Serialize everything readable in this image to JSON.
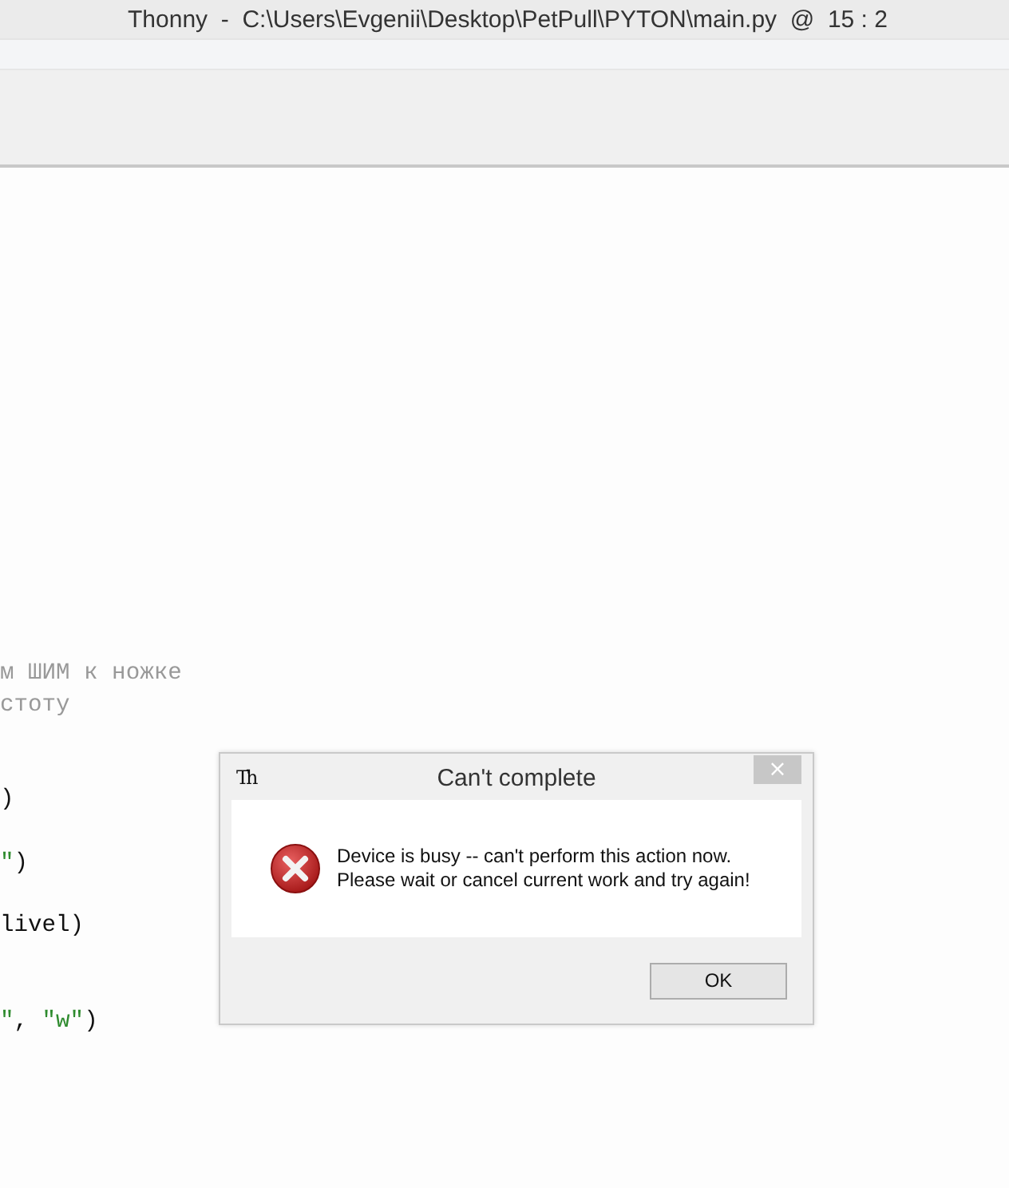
{
  "window": {
    "title": "Thonny  -  C:\\Users\\Evgenii\\Desktop\\PetPull\\PYTON\\main.py  @  15 : 2"
  },
  "code_lines": [
    {
      "segments": [
        {
          "kind": "comment",
          "text": "м ШИМ к ножке"
        }
      ]
    },
    {
      "segments": [
        {
          "kind": "comment",
          "text": "стоту"
        }
      ]
    },
    {
      "segments": [
        {
          "kind": "plain",
          "text": ")"
        }
      ]
    },
    {
      "segments": [
        {
          "kind": "string",
          "text": "\""
        },
        {
          "kind": "plain",
          "text": ")"
        }
      ]
    },
    {
      "segments": [
        {
          "kind": "plain",
          "text": "livel)"
        }
      ]
    },
    {
      "segments": [
        {
          "kind": "string",
          "text": "\""
        },
        {
          "kind": "plain",
          "text": ", "
        },
        {
          "kind": "string",
          "text": "\"w\""
        },
        {
          "kind": "plain",
          "text": ")"
        }
      ]
    }
  ],
  "dialog": {
    "app_icon": "Th",
    "title": "Can't complete",
    "close": "×",
    "message_lines": [
      "Device is busy -- can't perform this action now.",
      "Please wait or cancel current work and try again!"
    ],
    "buttons": [
      "OK"
    ]
  }
}
